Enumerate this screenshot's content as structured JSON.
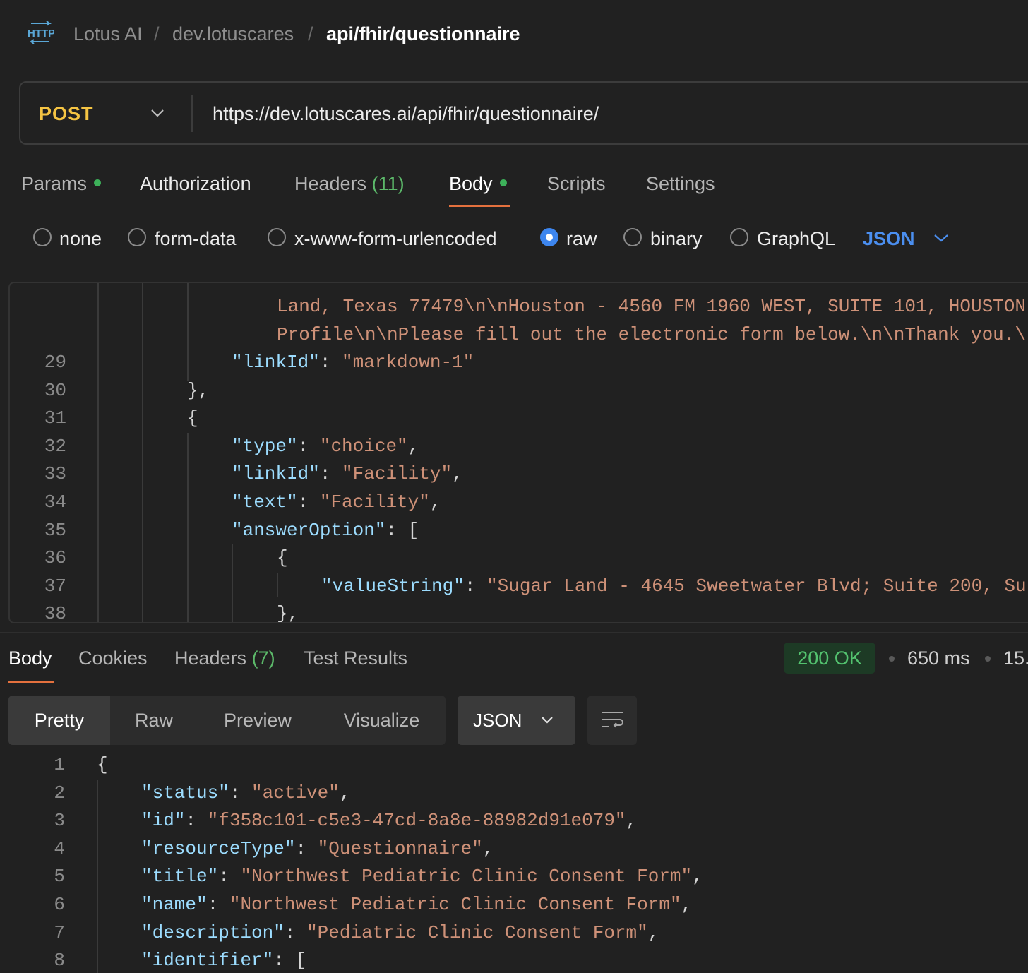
{
  "breadcrumb": {
    "icon": "http-icon",
    "items": [
      "Lotus AI",
      "dev.lotuscares",
      "api/fhir/questionnaire"
    ],
    "separator": "/"
  },
  "request": {
    "method": "POST",
    "url": "https://dev.lotuscares.ai/api/fhir/questionnaire/"
  },
  "request_tabs": [
    {
      "label": "Params",
      "indicator": true
    },
    {
      "label": "Authorization"
    },
    {
      "label": "Headers",
      "count": "(11)"
    },
    {
      "label": "Body",
      "indicator": true,
      "active": true
    },
    {
      "label": "Scripts"
    },
    {
      "label": "Settings"
    }
  ],
  "body_types": [
    {
      "label": "none"
    },
    {
      "label": "form-data"
    },
    {
      "label": "x-www-form-urlencoded"
    },
    {
      "label": "raw",
      "selected": true
    },
    {
      "label": "binary"
    },
    {
      "label": "GraphQL"
    }
  ],
  "body_format": "JSON",
  "request_body": {
    "lines": [
      {
        "num": "",
        "text": "Land, Texas 77479\\n\\nHouston - 4560 FM 1960 WEST, SUITE 101, HOUSTON"
      },
      {
        "num": "",
        "text": "Profile\\n\\nPlease fill out the electronic form below.\\n\\nThank you.\\"
      },
      {
        "num": "29",
        "key": "\"linkId\"",
        "value": "\"markdown-1\""
      },
      {
        "num": "30",
        "text": "},"
      },
      {
        "num": "31",
        "text": "{"
      },
      {
        "num": "32",
        "key": "\"type\"",
        "value": "\"choice\"",
        "comma": ","
      },
      {
        "num": "33",
        "key": "\"linkId\"",
        "value": "\"Facility\"",
        "comma": ","
      },
      {
        "num": "34",
        "key": "\"text\"",
        "value": "\"Facility\"",
        "comma": ","
      },
      {
        "num": "35",
        "key": "\"answerOption\"",
        "value": "["
      },
      {
        "num": "36",
        "text": "{"
      },
      {
        "num": "37",
        "key": "\"valueString\"",
        "value": "\"Sugar Land - 4645 Sweetwater Blvd; Suite 200, Su"
      },
      {
        "num": "38",
        "text": "},"
      }
    ]
  },
  "response_tabs": [
    {
      "label": "Body",
      "active": true
    },
    {
      "label": "Cookies"
    },
    {
      "label": "Headers",
      "count": "(7)"
    },
    {
      "label": "Test Results"
    }
  ],
  "response_meta": {
    "status": "200 OK",
    "time": "650 ms",
    "size": "15."
  },
  "view_modes": [
    "Pretty",
    "Raw",
    "Preview",
    "Visualize"
  ],
  "response_format": "JSON",
  "response_body": {
    "lines": [
      {
        "num": "1",
        "text": "{"
      },
      {
        "num": "2",
        "key": "\"status\"",
        "value": "\"active\"",
        "comma": ","
      },
      {
        "num": "3",
        "key": "\"id\"",
        "value": "\"f358c101-c5e3-47cd-8a8e-88982d91e079\"",
        "comma": ","
      },
      {
        "num": "4",
        "key": "\"resourceType\"",
        "value": "\"Questionnaire\"",
        "comma": ","
      },
      {
        "num": "5",
        "key": "\"title\"",
        "value": "\"Northwest Pediatric Clinic Consent Form\"",
        "comma": ","
      },
      {
        "num": "6",
        "key": "\"name\"",
        "value": "\"Northwest Pediatric Clinic Consent Form\"",
        "comma": ","
      },
      {
        "num": "7",
        "key": "\"description\"",
        "value": "\"Pediatric Clinic Consent Form\"",
        "comma": ","
      },
      {
        "num": "8",
        "key": "\"identifier\"",
        "value": "["
      }
    ]
  }
}
